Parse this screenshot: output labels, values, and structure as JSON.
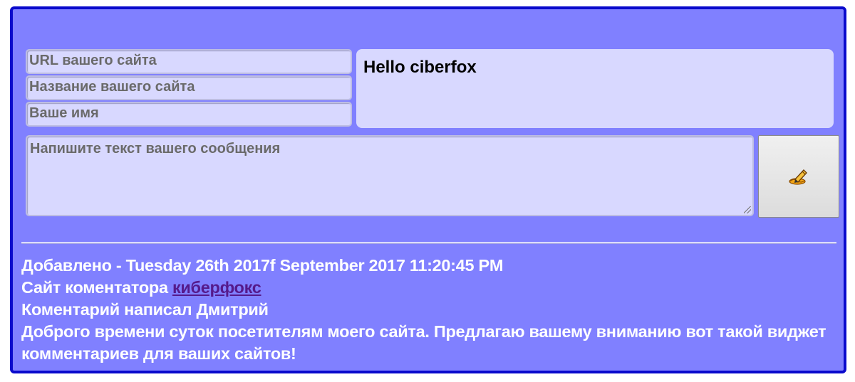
{
  "form": {
    "url_placeholder": "URL вашего сайта",
    "site_name_placeholder": "Название вашего сайта",
    "name_placeholder": "Ваше имя",
    "message_placeholder": "Напишите текст вашего сообщения",
    "preview_text": "Hello ciberfox",
    "send_button_icon": "pencil-icon"
  },
  "comment": {
    "added_prefix": "Добавлено - ",
    "added_date": "Tuesday 26th 2017f September 2017 11:20:45 PM",
    "site_prefix": "Сайт коментатора ",
    "site_link_text": "киберфокс",
    "author_line": "Коментарий написал Дмитрий",
    "text": "Доброго времени суток посетителям моего сайта. Предлагаю вашему вниманию вот такой виджет комментариев для ваших сайтов!"
  },
  "colors": {
    "background": "#8080ff",
    "border": "#0a0acc",
    "field": "#d8d8ff",
    "link": "#551a8b"
  }
}
